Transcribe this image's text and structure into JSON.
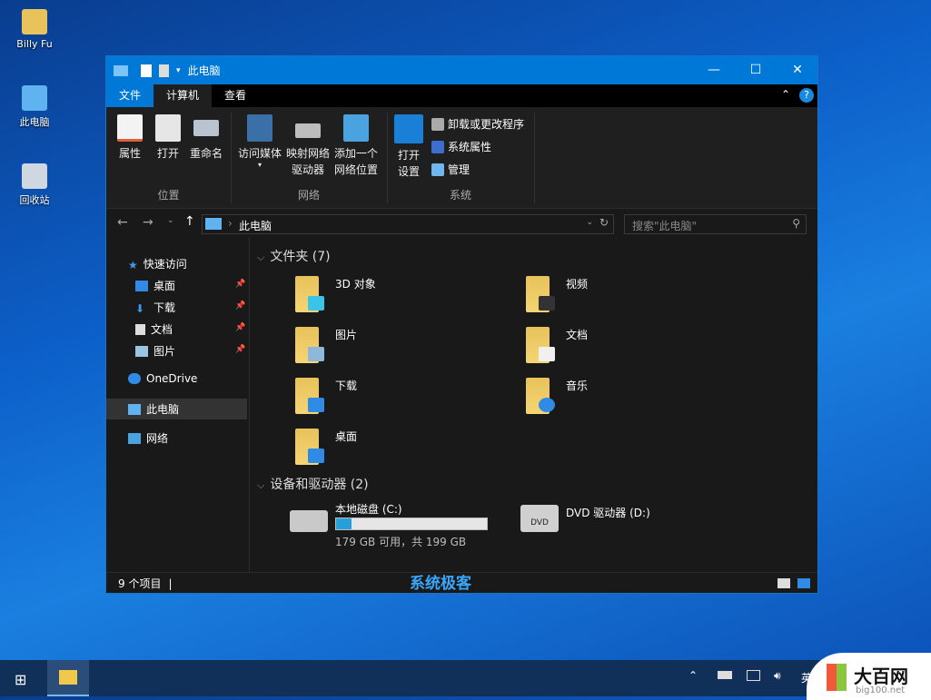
{
  "desktop": {
    "icons": [
      {
        "label": "Billy Fu"
      },
      {
        "label": "此电脑"
      },
      {
        "label": "回收站"
      }
    ]
  },
  "window": {
    "title": "此电脑",
    "controls": {
      "minimize": "—",
      "maximize": "☐",
      "close": "✕"
    }
  },
  "tabs": [
    {
      "label": "文件"
    },
    {
      "label": "计算机"
    },
    {
      "label": "查看"
    }
  ],
  "ribbon": {
    "location": {
      "label": "位置",
      "buttons": [
        "属性",
        "打开",
        "重命名"
      ]
    },
    "network": {
      "label": "网络",
      "buttons": [
        "访问媒体",
        "映射网络\n驱动器",
        "添加一个\n网络位置"
      ]
    },
    "system": {
      "label": "系统",
      "open_settings": "打开\n设置",
      "small": [
        "卸载或更改程序",
        "系统属性",
        "管理"
      ]
    }
  },
  "address": {
    "path": "此电脑",
    "search_placeholder": "搜索\"此电脑\""
  },
  "nav": {
    "quick_access": "快速访问",
    "items": [
      "桌面",
      "下载",
      "文档",
      "图片"
    ],
    "onedrive": "OneDrive",
    "this_pc": "此电脑",
    "network": "网络"
  },
  "content": {
    "folders_header": "文件夹 (7)",
    "folders": [
      "3D 对象",
      "视频",
      "图片",
      "文档",
      "下载",
      "音乐",
      "桌面"
    ],
    "devices_header": "设备和驱动器 (2)",
    "drives": [
      {
        "name": "本地磁盘 (C:)",
        "info": "179 GB 可用，共 199 GB",
        "used_fraction": 0.1
      },
      {
        "name": "DVD 驱动器 (D:)"
      }
    ]
  },
  "status": {
    "items": "9 个项目"
  },
  "watermark": "系统极客",
  "logo": {
    "name": "大百网",
    "url": "big100.net"
  },
  "tray": {
    "lang": "英"
  },
  "colors": {
    "accent": "#0078d7",
    "drive_bar": "#26a0da"
  }
}
